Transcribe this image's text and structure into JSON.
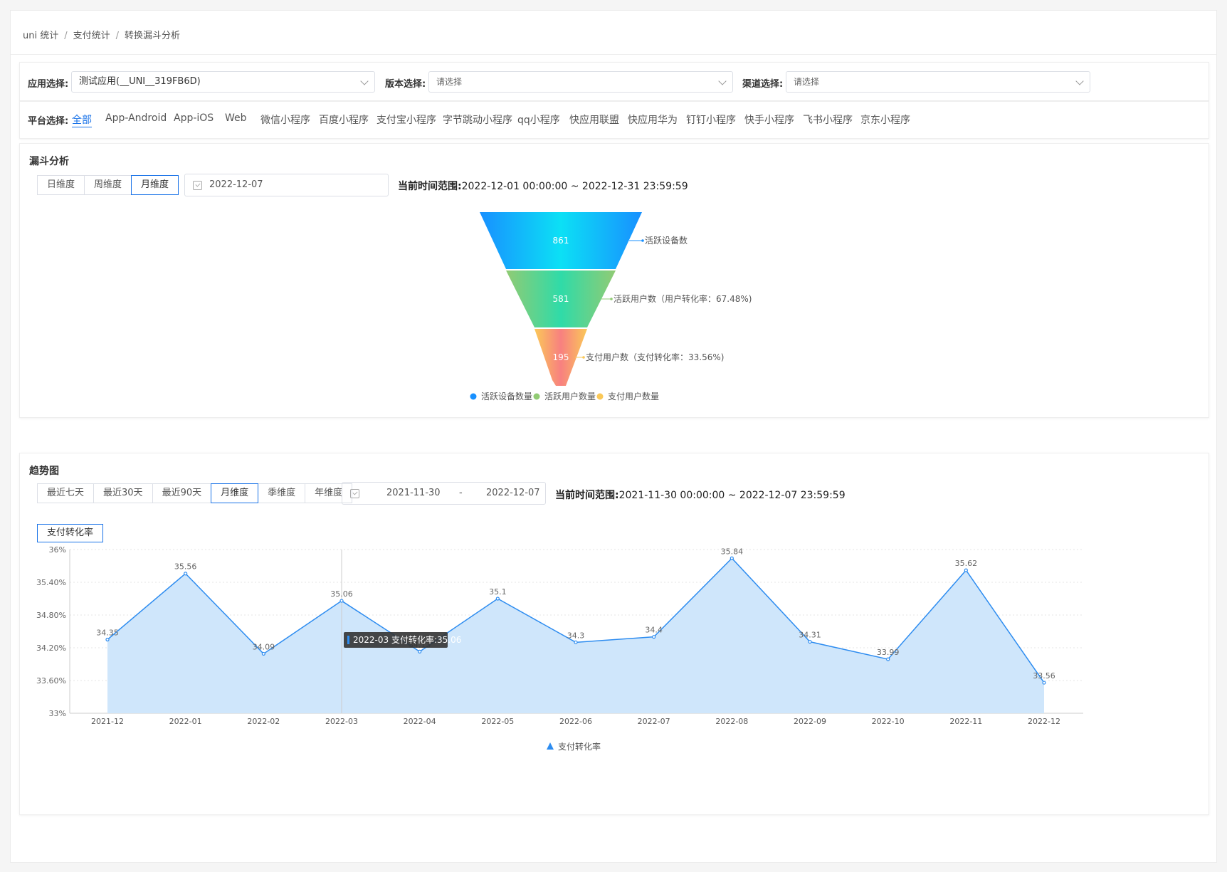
{
  "breadcrumb": [
    "uni 统计",
    "支付统计",
    "转换漏斗分析"
  ],
  "filters": {
    "app_label": "应用选择:",
    "app_value": "测试应用(__UNI__319FB6D)",
    "version_label": "版本选择:",
    "version_placeholder": "请选择",
    "channel_label": "渠道选择:",
    "channel_placeholder": "请选择"
  },
  "platform": {
    "label": "平台选择:",
    "items": [
      "全部",
      "App-Android",
      "App-iOS",
      "Web",
      "微信小程序",
      "百度小程序",
      "支付宝小程序",
      "字节跳动小程序",
      "qq小程序",
      "快应用联盟",
      "快应用华为",
      "钉钉小程序",
      "快手小程序",
      "飞书小程序",
      "京东小程序"
    ],
    "active_index": 0
  },
  "funnel": {
    "title": "漏斗分析",
    "dimensions": [
      "日维度",
      "周维度",
      "月维度"
    ],
    "active_dimension": 2,
    "date": "2022-12-07",
    "range_label": "当前时间范围:",
    "range_value": "2022-12-01 00:00:00 ~ 2022-12-31 23:59:59",
    "stages": [
      {
        "value": "861",
        "label": "活跃设备数"
      },
      {
        "value": "581",
        "label": "活跃用户数（用户转化率：67.48%)"
      },
      {
        "value": "195",
        "label": "支付用户数（支付转化率：33.56%)"
      }
    ],
    "legend": [
      {
        "name": "活跃设备数量",
        "color": "#1890ff"
      },
      {
        "name": "活跃用户数量",
        "color": "#91cb74"
      },
      {
        "name": "支付用户数量",
        "color": "#fac858"
      }
    ]
  },
  "trend": {
    "title": "趋势图",
    "ranges": [
      "最近七天",
      "最近30天",
      "最近90天",
      "月维度",
      "季维度",
      "年维度"
    ],
    "active_range": 3,
    "date_start": "2021-11-30",
    "date_sep": "-",
    "date_end": "2022-12-07",
    "range_label": "当前时间范围:",
    "range_value": "2021-11-30 00:00:00 ~ 2022-12-07 23:59:59",
    "metric": "支付转化率",
    "tooltip": "2022-03 支付转化率:35.06"
  },
  "chart_data": {
    "type": "area",
    "x": [
      "2021-12",
      "2022-01",
      "2022-02",
      "2022-03",
      "2022-04",
      "2022-05",
      "2022-06",
      "2022-07",
      "2022-08",
      "2022-09",
      "2022-10",
      "2022-11",
      "2022-12"
    ],
    "series": [
      {
        "name": "支付转化率",
        "values": [
          34.35,
          35.56,
          34.09,
          35.06,
          34.13,
          35.1,
          34.3,
          34.4,
          35.84,
          34.31,
          33.99,
          35.62,
          33.56
        ],
        "labels": [
          "34.35",
          "35.56",
          "34.09",
          "35.06",
          "34.13",
          "35.1",
          "34.3",
          "34.4",
          "35.84",
          "34.31",
          "33.99",
          "35.62",
          "33.56"
        ]
      }
    ],
    "ylim": [
      33,
      36
    ],
    "yticks": [
      33,
      33.6,
      34.2,
      34.8,
      35.4,
      36
    ],
    "ytick_labels": [
      "33%",
      "33.60%",
      "34.20%",
      "34.80%",
      "35.40%",
      "36%"
    ],
    "line_color": "#2d8cf0",
    "area_color": "#cfe6fb",
    "grid": true,
    "legend": "bottom-center"
  }
}
